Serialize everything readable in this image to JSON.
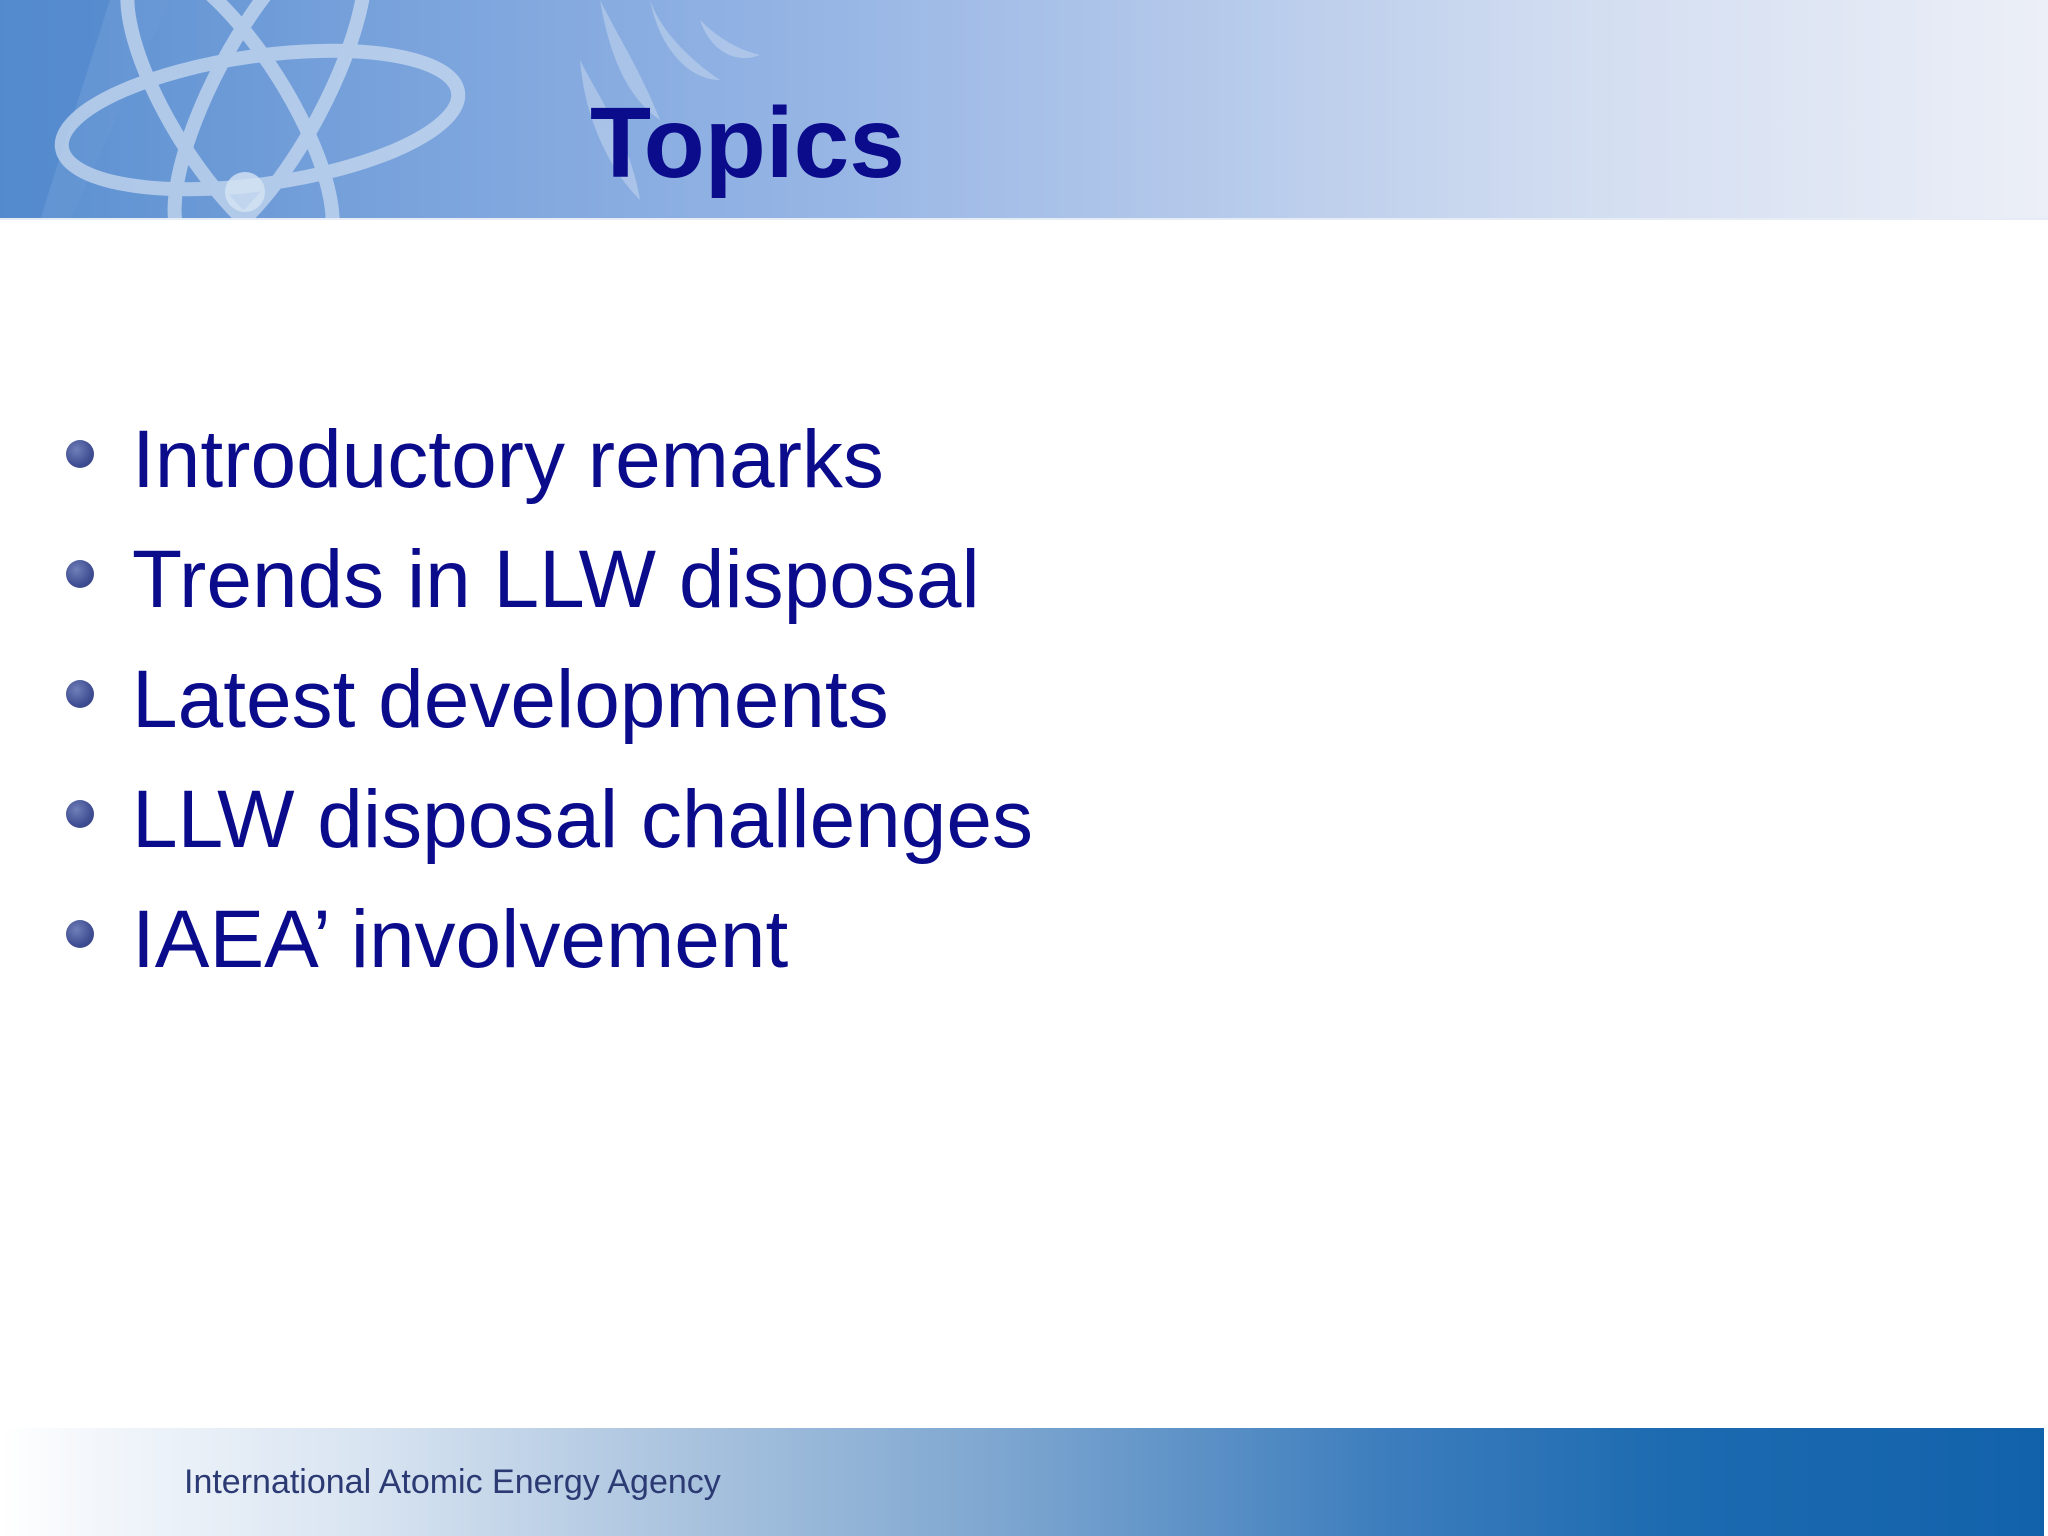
{
  "header": {
    "title": "Topics"
  },
  "topics": [
    {
      "label": "Introductory remarks"
    },
    {
      "label": "Trends in LLW disposal"
    },
    {
      "label": "Latest developments"
    },
    {
      "label": "LLW disposal challenges"
    },
    {
      "label": "IAEA’ involvement"
    }
  ],
  "footer": {
    "organization": "International Atomic Energy Agency"
  },
  "colors": {
    "title_text": "#0b0c8c",
    "bullet": "#3f4e92",
    "footer_text": "#2c3a74",
    "footer_band_end": "#1262ab",
    "header_band_start": "#5a8fd0"
  },
  "icons": {
    "header_decoration": "atom-logo-watermark",
    "bullet": "bullet-dot-icon"
  }
}
